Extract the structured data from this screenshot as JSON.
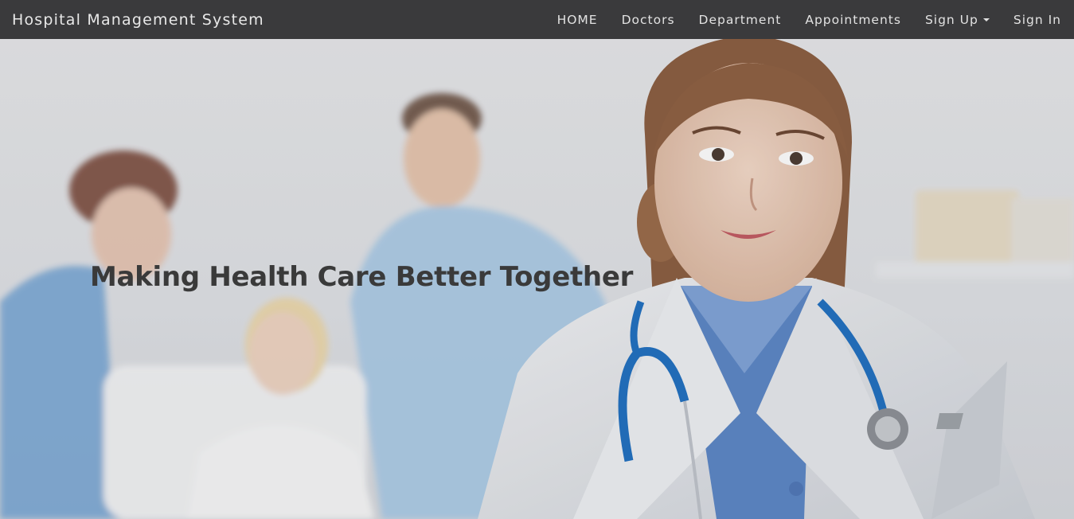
{
  "navbar": {
    "brand": "Hospital Management System",
    "links": {
      "home": "HOME",
      "doctors": "Doctors",
      "department": "Department",
      "appointments": "Appointments",
      "signup": "Sign Up",
      "signin": "Sign In"
    }
  },
  "hero": {
    "headline": "Making Health Care Better Together",
    "image": "hero-doctors-photo"
  }
}
